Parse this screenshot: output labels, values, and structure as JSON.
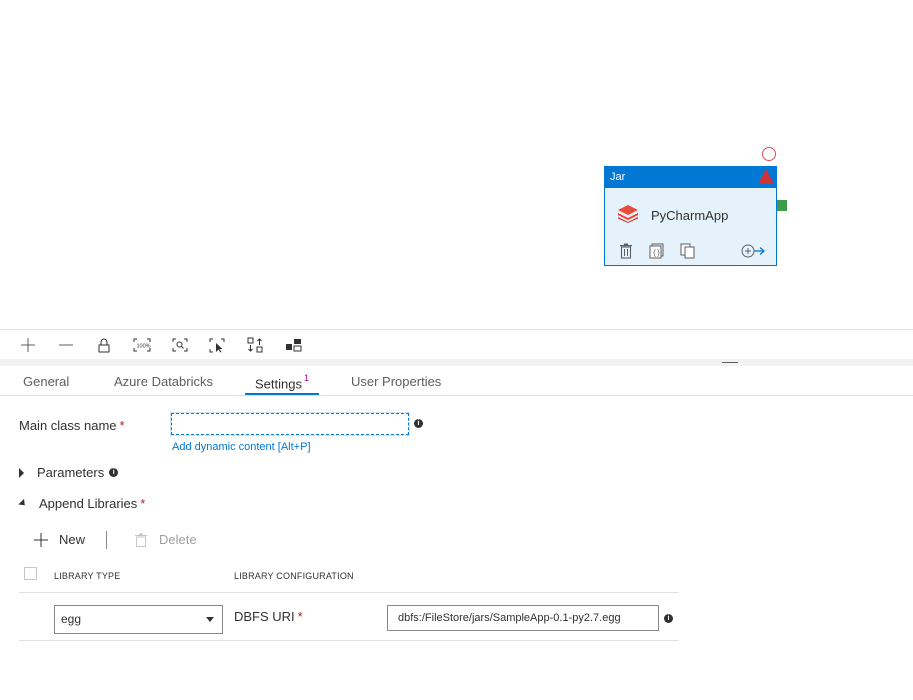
{
  "node": {
    "type_label": "Jar",
    "name": "PyCharmApp",
    "icons": [
      "databricks-icon",
      "delete-icon",
      "code-icon",
      "copy-icon",
      "add-output-icon",
      "warning-icon"
    ]
  },
  "toolbar": {
    "icons": [
      "zoom-in-icon",
      "zoom-out-icon",
      "lock-icon",
      "zoom-100-icon",
      "zoom-to-fit-icon",
      "select-icon",
      "auto-align-icon",
      "layout-icon"
    ]
  },
  "tabs": [
    {
      "label": "General"
    },
    {
      "label": "Azure Databricks"
    },
    {
      "label": "Settings",
      "badge": "1"
    },
    {
      "label": "User Properties"
    }
  ],
  "form": {
    "main_class_label": "Main class name",
    "required_mark": "*",
    "main_class_value": "",
    "dynamic_link": "Add dynamic content [Alt+P]",
    "parameters_label": "Parameters",
    "append_libraries_label": "Append Libraries"
  },
  "libraries": {
    "new_label": "New",
    "delete_label": "Delete",
    "col_type": "LIBRARY TYPE",
    "col_config": "LIBRARY CONFIGURATION",
    "rows": [
      {
        "type": "egg",
        "config_label": "DBFS URI",
        "config_value": "dbfs:/FileStore/jars/SampleApp-0.1-py2.7.egg"
      }
    ]
  },
  "colors": {
    "accent": "#0078d4",
    "warning": "#d13438",
    "required": "#a4262c",
    "databricks": "#e74c3c",
    "output": "#3e9b4a"
  }
}
